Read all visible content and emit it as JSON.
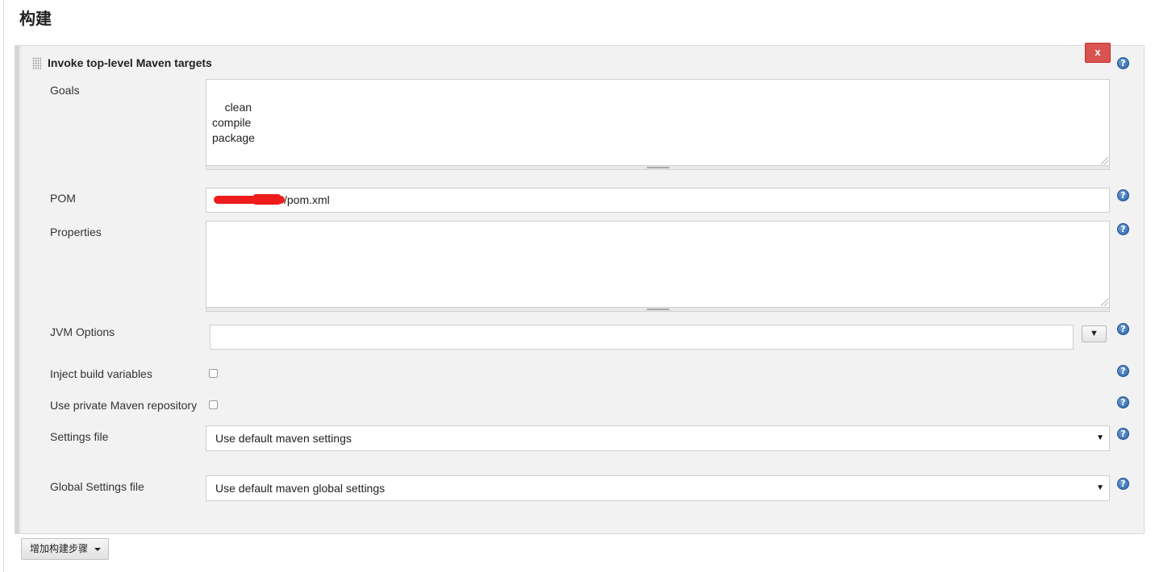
{
  "section": {
    "title": "构建"
  },
  "build_step": {
    "title": "Invoke top-level Maven targets",
    "delete_label": "x",
    "help_icon_glyph": "?",
    "fields": {
      "goals": {
        "label": "Goals",
        "value": "clean\ncompile\npackage"
      },
      "pom": {
        "label": "POM",
        "value_visible": "/pom.xml",
        "redacted": true
      },
      "properties": {
        "label": "Properties",
        "value": ""
      },
      "jvm_options": {
        "label": "JVM Options",
        "value": "",
        "dropdown_glyph": "▼"
      },
      "inject_build_variables": {
        "label": "Inject build variables",
        "checked": false
      },
      "use_private_repo": {
        "label": "Use private Maven repository",
        "checked": false
      },
      "settings_file": {
        "label": "Settings file",
        "selected": "Use default maven settings",
        "arrow": "▼"
      },
      "global_settings_file": {
        "label": "Global Settings file",
        "selected": "Use default maven global settings",
        "arrow": "▼"
      }
    }
  },
  "add_step_button": {
    "label": "增加构建步骤"
  },
  "colors": {
    "delete_red": "#d9534f",
    "help_blue": "#2c63a8",
    "panel_bg": "#f2f2f2",
    "redaction": "#ee1c1c"
  }
}
